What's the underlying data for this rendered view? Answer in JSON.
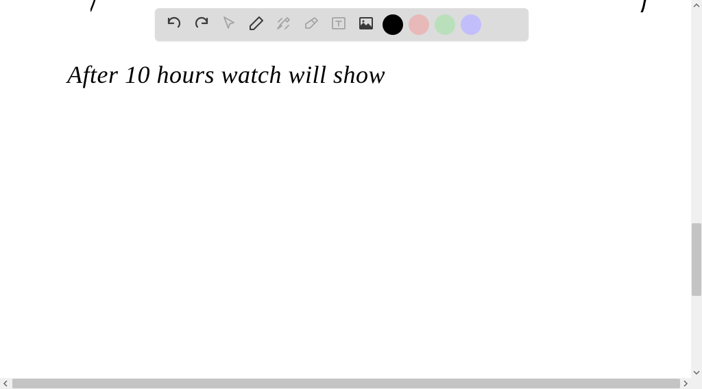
{
  "toolbar": {
    "tools": [
      {
        "name": "undo",
        "icon": "undo-icon",
        "disabled": false
      },
      {
        "name": "redo",
        "icon": "redo-icon",
        "disabled": false
      },
      {
        "name": "pointer",
        "icon": "pointer-icon",
        "disabled": true
      },
      {
        "name": "pencil",
        "icon": "pencil-icon",
        "disabled": false
      },
      {
        "name": "tools",
        "icon": "tools-icon",
        "disabled": true
      },
      {
        "name": "eraser",
        "icon": "eraser-icon",
        "disabled": true
      },
      {
        "name": "text",
        "icon": "text-icon",
        "disabled": true
      },
      {
        "name": "image",
        "icon": "image-icon",
        "disabled": false
      }
    ],
    "colors": [
      {
        "name": "black",
        "hex": "#000000",
        "selected": true
      },
      {
        "name": "pink",
        "hex": "#e8b9b9",
        "selected": false
      },
      {
        "name": "green",
        "hex": "#b9e0bb",
        "selected": false
      },
      {
        "name": "purple",
        "hex": "#c2befc",
        "selected": false
      }
    ]
  },
  "handwriting": {
    "top_fragment_left": "f",
    "top_fragment_right": "",
    "main_line": "After 10 hours watch will show"
  },
  "scroll": {
    "vertical_position_pct": 59,
    "horizontal_position_pct": 2
  }
}
